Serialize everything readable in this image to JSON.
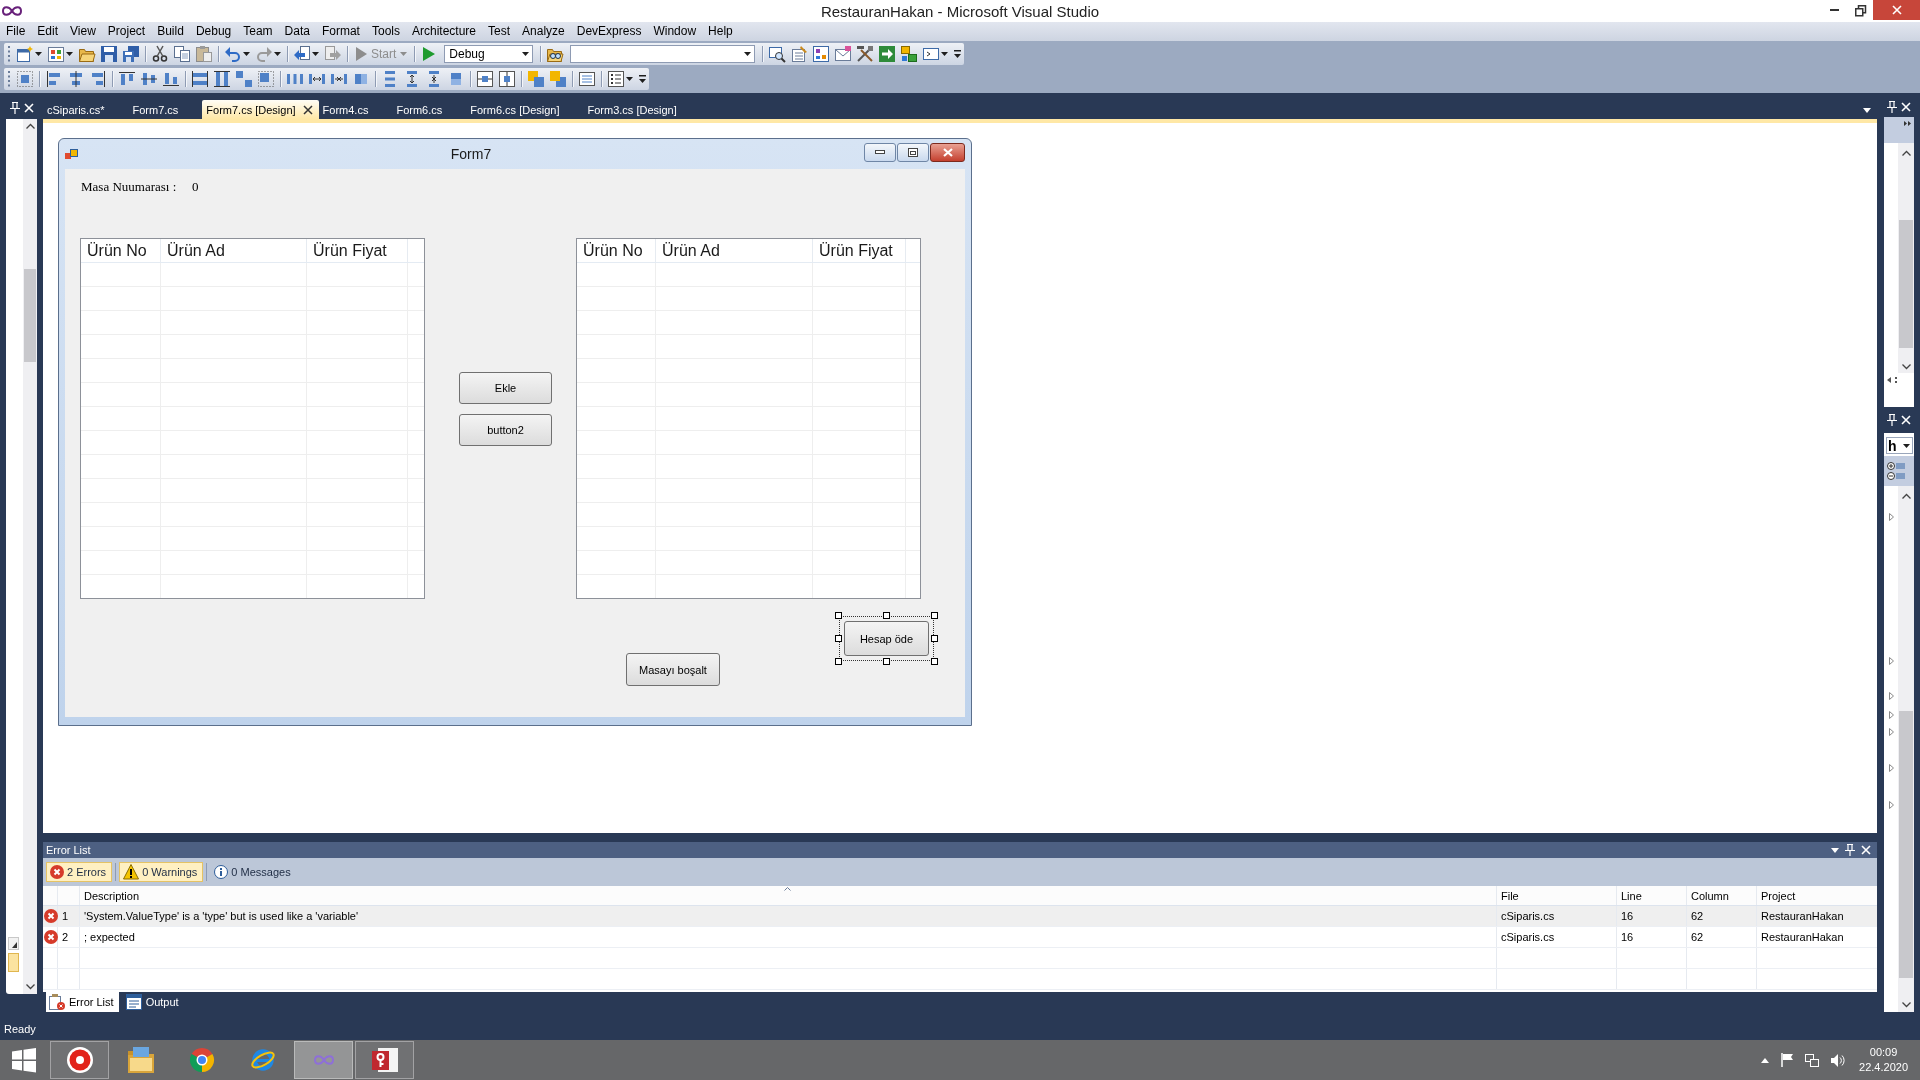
{
  "window": {
    "title": "RestauranHakan - Microsoft Visual Studio"
  },
  "menu_bar": [
    "File",
    "Edit",
    "View",
    "Project",
    "Build",
    "Debug",
    "Team",
    "Data",
    "Format",
    "Tools",
    "Architecture",
    "Test",
    "Analyze",
    "DevExpress",
    "Window",
    "Help"
  ],
  "toolbar": {
    "start_button": {
      "label": "Start",
      "disabled": true
    },
    "configuration": "Debug"
  },
  "document_tabs": [
    {
      "label": "cSiparis.cs*",
      "selected": false
    },
    {
      "label": "Form7.cs",
      "selected": false
    },
    {
      "label": "Form7.cs [Design]",
      "selected": true
    },
    {
      "label": "Form4.cs",
      "selected": false
    },
    {
      "label": "Form6.cs",
      "selected": false
    },
    {
      "label": "Form6.cs [Design]",
      "selected": false
    },
    {
      "label": "Form3.cs [Design]",
      "selected": false
    }
  ],
  "designer_form": {
    "title": "Form7",
    "table_label": "Masa Nuumarası :",
    "table_number": "0",
    "grids": [
      {
        "columns": [
          "Ürün No",
          "Ürün Ad",
          "Ürün Fiyat"
        ]
      },
      {
        "columns": [
          "Ürün No",
          "Ürün Ad",
          "Ürün Fiyat"
        ]
      }
    ],
    "buttons": [
      {
        "label": "Ekle",
        "selected": false
      },
      {
        "label": "button2",
        "selected": false
      },
      {
        "label": "Hesap öde",
        "selected": true
      },
      {
        "label": "Masayı boşalt",
        "selected": false
      }
    ]
  },
  "error_list": {
    "title": "Error List",
    "filters": [
      {
        "kind": "error",
        "label": "2 Errors",
        "selected": true
      },
      {
        "kind": "warning",
        "label": "0 Warnings",
        "selected": true
      },
      {
        "kind": "message",
        "label": "0 Messages",
        "selected": false
      }
    ],
    "columns": [
      "Description",
      "File",
      "Line",
      "Column",
      "Project"
    ],
    "rows": [
      {
        "kind": "error",
        "number": "1",
        "description": "'System.ValueType' is a 'type' but is used like a 'variable'",
        "file": "cSiparis.cs",
        "line": "16",
        "column": "62",
        "project": "RestauranHakan",
        "selected": true
      },
      {
        "kind": "error",
        "number": "2",
        "description": "; expected",
        "file": "cSiparis.cs",
        "line": "16",
        "column": "62",
        "project": "RestauranHakan",
        "selected": false
      }
    ]
  },
  "tool_window_tabs": [
    {
      "kind": "error_list",
      "label": "Error List",
      "selected": true
    },
    {
      "kind": "output",
      "label": "Output",
      "selected": false
    }
  ],
  "properties_panel": {
    "object_combo": "h"
  },
  "status_bar": {
    "text": "Ready"
  },
  "taskbar": {
    "apps": [
      {
        "kind": "yandex",
        "running": true,
        "selected": false
      },
      {
        "kind": "explorer",
        "running": false,
        "selected": false
      },
      {
        "kind": "chrome",
        "running": false,
        "selected": false
      },
      {
        "kind": "ie",
        "running": false,
        "selected": false
      },
      {
        "kind": "visual_studio",
        "running": true,
        "selected": true
      },
      {
        "kind": "access",
        "running": true,
        "selected": false
      }
    ],
    "clock": {
      "time": "00:09",
      "date": "22.4.2020"
    }
  }
}
